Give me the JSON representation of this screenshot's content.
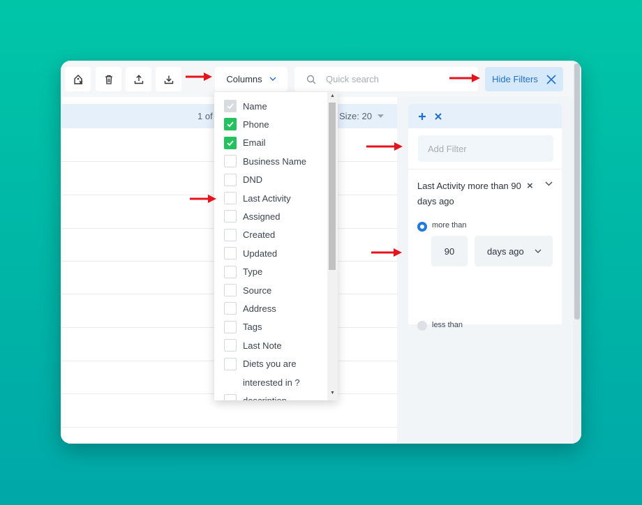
{
  "toolbar": {
    "icons": [
      "tag-remove-icon",
      "trash-icon",
      "upload-icon",
      "download-icon"
    ],
    "columns_label": "Columns",
    "search_placeholder": "Quick search",
    "hide_filters_label": "Hide Filters"
  },
  "table": {
    "pager_text": "1 of",
    "page_size_text": "Size: 20"
  },
  "columns_menu": {
    "items": [
      {
        "label": "Name",
        "state": "disabled"
      },
      {
        "label": "Phone",
        "state": "checked"
      },
      {
        "label": "Email",
        "state": "checked"
      },
      {
        "label": "Business Name",
        "state": "unchecked"
      },
      {
        "label": "DND",
        "state": "unchecked"
      },
      {
        "label": "Last Activity",
        "state": "unchecked"
      },
      {
        "label": "Assigned",
        "state": "unchecked"
      },
      {
        "label": "Created",
        "state": "unchecked"
      },
      {
        "label": "Updated",
        "state": "unchecked"
      },
      {
        "label": "Type",
        "state": "unchecked"
      },
      {
        "label": "Source",
        "state": "unchecked"
      },
      {
        "label": "Address",
        "state": "unchecked"
      },
      {
        "label": "Tags",
        "state": "unchecked"
      },
      {
        "label": "Last Note",
        "state": "unchecked"
      },
      {
        "label": "Diets you are",
        "state": "unchecked"
      },
      {
        "label": "interested in ?",
        "state": "none"
      },
      {
        "label": "description",
        "state": "unchecked"
      }
    ]
  },
  "filters": {
    "add_icon": "plus-icon",
    "clear_icon": "close-icon",
    "add_filter_placeholder": "Add Filter",
    "rule_text": "Last Activity more than 90 days ago",
    "option_more": "more than",
    "option_less": "less than",
    "selected_option": "more than",
    "value": "90",
    "unit": "days ago"
  },
  "colors": {
    "background": "#00bfa5",
    "accent_blue": "#1e6fd0",
    "check_green": "#21c35c",
    "annotation_arrow": "#e8121c"
  }
}
